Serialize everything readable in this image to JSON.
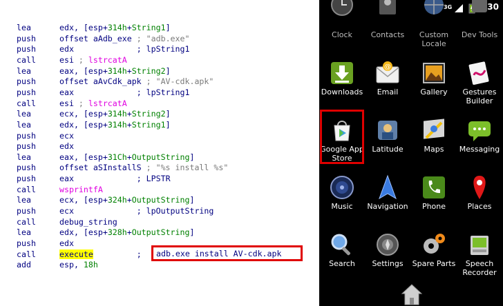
{
  "code": {
    "lines": [
      {
        "mn": "lea",
        "parts": [
          [
            "blk",
            "edx, [esp+"
          ],
          [
            "grn",
            "314h"
          ],
          [
            "blk",
            "+"
          ],
          [
            "grn",
            "String1"
          ],
          [
            "blk",
            "]"
          ]
        ]
      },
      {
        "mn": "push",
        "parts": [
          [
            "blk",
            "offset aAdb_exe "
          ],
          [
            "cmt",
            "; \"adb.exe\""
          ]
        ]
      },
      {
        "mn": "push",
        "parts": [
          [
            "blk",
            "edx             "
          ],
          [
            "blk",
            "; lpString1"
          ]
        ]
      },
      {
        "mn": "call",
        "parts": [
          [
            "blk",
            "esi "
          ],
          [
            "cmt",
            "; "
          ],
          [
            "mag",
            "lstrcatA"
          ]
        ]
      },
      {
        "mn": "lea",
        "parts": [
          [
            "blk",
            "eax, [esp+"
          ],
          [
            "grn",
            "314h"
          ],
          [
            "blk",
            "+"
          ],
          [
            "grn",
            "String2"
          ],
          [
            "blk",
            "]"
          ]
        ]
      },
      {
        "mn": "push",
        "parts": [
          [
            "blk",
            "offset aAvCdk_apk "
          ],
          [
            "cmt",
            "; \"AV-cdk.apk\""
          ]
        ]
      },
      {
        "mn": "push",
        "parts": [
          [
            "blk",
            "eax             "
          ],
          [
            "blk",
            "; lpString1"
          ]
        ]
      },
      {
        "mn": "call",
        "parts": [
          [
            "blk",
            "esi "
          ],
          [
            "cmt",
            "; "
          ],
          [
            "mag",
            "lstrcatA"
          ]
        ]
      },
      {
        "mn": "lea",
        "parts": [
          [
            "blk",
            "ecx, [esp+"
          ],
          [
            "grn",
            "314h"
          ],
          [
            "blk",
            "+"
          ],
          [
            "grn",
            "String2"
          ],
          [
            "blk",
            "]"
          ]
        ]
      },
      {
        "mn": "lea",
        "parts": [
          [
            "blk",
            "edx, [esp+"
          ],
          [
            "grn",
            "314h"
          ],
          [
            "blk",
            "+"
          ],
          [
            "grn",
            "String1"
          ],
          [
            "blk",
            "]"
          ]
        ]
      },
      {
        "mn": "push",
        "parts": [
          [
            "blk",
            "ecx"
          ]
        ]
      },
      {
        "mn": "push",
        "parts": [
          [
            "blk",
            "edx"
          ]
        ]
      },
      {
        "mn": "lea",
        "parts": [
          [
            "blk",
            "eax, [esp+"
          ],
          [
            "grn",
            "31Ch"
          ],
          [
            "blk",
            "+"
          ],
          [
            "grn",
            "OutputString"
          ],
          [
            "blk",
            "]"
          ]
        ]
      },
      {
        "mn": "push",
        "parts": [
          [
            "blk",
            "offset aSInstallS "
          ],
          [
            "cmt",
            "; \"%s install %s\""
          ]
        ]
      },
      {
        "mn": "push",
        "parts": [
          [
            "blk",
            "eax             "
          ],
          [
            "blk",
            "; LPSTR"
          ]
        ]
      },
      {
        "mn": "call",
        "parts": [
          [
            "mag",
            "wsprintfA"
          ]
        ]
      },
      {
        "mn": "lea",
        "parts": [
          [
            "blk",
            "ecx, [esp+"
          ],
          [
            "grn",
            "324h"
          ],
          [
            "blk",
            "+"
          ],
          [
            "grn",
            "OutputString"
          ],
          [
            "blk",
            "]"
          ]
        ]
      },
      {
        "mn": "push",
        "parts": [
          [
            "blk",
            "ecx             "
          ],
          [
            "blk",
            "; lpOutputString"
          ]
        ]
      },
      {
        "mn": "call",
        "parts": [
          [
            "blk",
            "debug_string"
          ]
        ]
      },
      {
        "mn": "lea",
        "parts": [
          [
            "blk",
            "edx, [esp+"
          ],
          [
            "grn",
            "328h"
          ],
          [
            "blk",
            "+"
          ],
          [
            "grn",
            "OutputString"
          ],
          [
            "blk",
            "]"
          ]
        ]
      },
      {
        "mn": "push",
        "parts": [
          [
            "blk",
            "edx"
          ]
        ]
      },
      {
        "mn": "call",
        "parts": [
          [
            "hl",
            "execute"
          ],
          [
            "blk",
            "         ;"
          ]
        ]
      },
      {
        "mn": "add",
        "parts": [
          [
            "blk",
            "esp, "
          ],
          [
            "grn",
            "18h"
          ]
        ]
      }
    ],
    "highlight_comment": "adb.exe install AV-cdk.apk"
  },
  "phone": {
    "status": {
      "time": "1:30",
      "net": "3G"
    },
    "apps": [
      {
        "label": "Clock",
        "icon": "clock-icon",
        "dim": true
      },
      {
        "label": "Contacts",
        "icon": "contacts-icon",
        "dim": true
      },
      {
        "label": "Custom\nLocale",
        "icon": "locale-icon",
        "dim": true
      },
      {
        "label": "Dev Tools",
        "icon": "dev-tools-icon",
        "dim": true
      },
      {
        "label": "Downloads",
        "icon": "downloads-icon"
      },
      {
        "label": "Email",
        "icon": "email-icon"
      },
      {
        "label": "Gallery",
        "icon": "gallery-icon"
      },
      {
        "label": "Gestures\nBuilder",
        "icon": "gestures-icon"
      },
      {
        "label": "Google App\nStore",
        "icon": "app-store-icon"
      },
      {
        "label": "Latitude",
        "icon": "latitude-icon"
      },
      {
        "label": "Maps",
        "icon": "maps-icon"
      },
      {
        "label": "Messaging",
        "icon": "messaging-icon"
      },
      {
        "label": "Music",
        "icon": "music-icon"
      },
      {
        "label": "Navigation",
        "icon": "navigation-icon"
      },
      {
        "label": "Phone",
        "icon": "phone-icon"
      },
      {
        "label": "Places",
        "icon": "places-icon"
      },
      {
        "label": "Search",
        "icon": "search-icon"
      },
      {
        "label": "Settings",
        "icon": "settings-icon"
      },
      {
        "label": "Spare Parts",
        "icon": "spare-parts-icon"
      },
      {
        "label": "Speech\nRecorder",
        "icon": "speech-recorder-icon"
      }
    ]
  }
}
